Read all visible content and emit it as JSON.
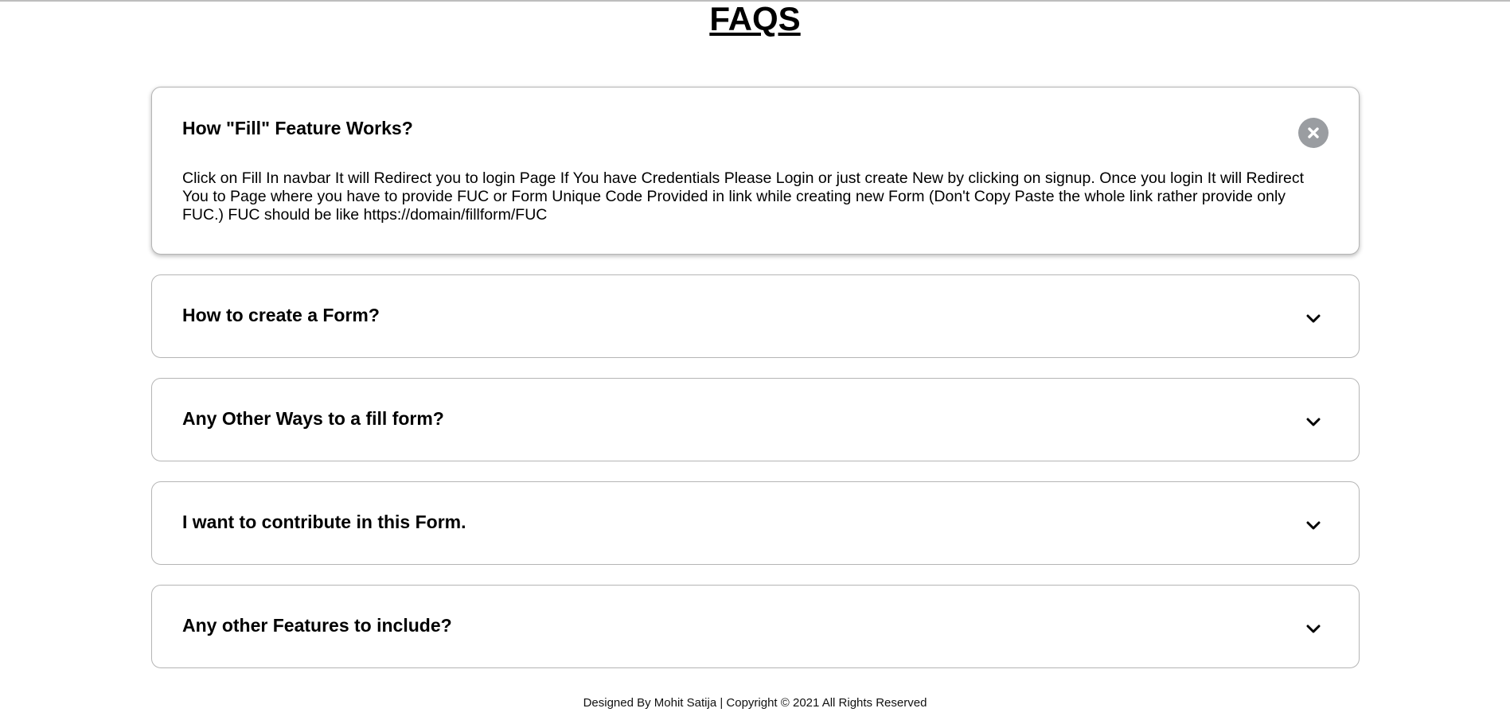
{
  "page": {
    "title": "FAQS"
  },
  "faqs": [
    {
      "question": "How \"Fill\" Feature Works?",
      "answer": "Click on Fill In navbar It will Redirect you to login Page If You have Credentials Please Login or just create New by clicking on signup. Once you login It will Redirect You to Page where you have to provide FUC or Form Unique Code Provided in link while creating new Form (Don't Copy Paste the whole link rather provide only FUC.) FUC should be like https://domain/fillform/FUC",
      "expanded": true,
      "toggle_icon": "close-icon"
    },
    {
      "question": "How to create a Form?",
      "expanded": false,
      "toggle_icon": "chevron-down-icon"
    },
    {
      "question": "Any Other Ways to a fill form?",
      "expanded": false,
      "toggle_icon": "chevron-down-icon"
    },
    {
      "question": "I want to contribute in this Form.",
      "expanded": false,
      "toggle_icon": "chevron-down-icon"
    },
    {
      "question": "Any other Features to include?",
      "expanded": false,
      "toggle_icon": "chevron-down-icon"
    }
  ],
  "footer": {
    "text": "Designed By Mohit Satija | Copyright © 2021 All Rights Reserved"
  },
  "colors": {
    "close_button_bg": "#9a9da1",
    "card_border": "#b5b5b5"
  }
}
